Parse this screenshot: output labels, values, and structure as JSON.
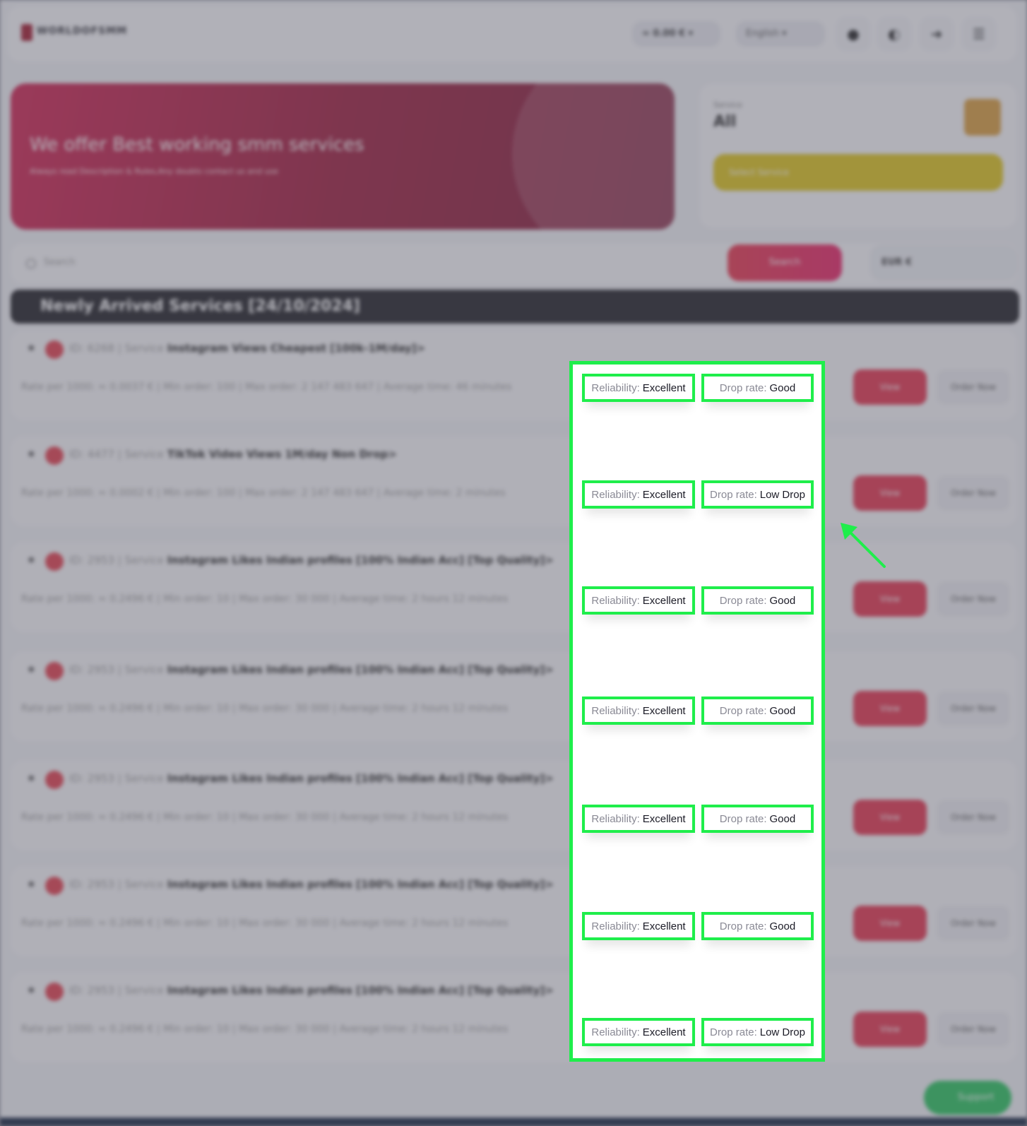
{
  "header": {
    "logo_text": "WORLDOFSMM",
    "balance": "≈ 0.00 € ▾",
    "language": "English ▾"
  },
  "hero": {
    "title": "We offer Best working smm services",
    "subtitle": "Always read Description & Rules,Any doubts contact us and use"
  },
  "service_selector": {
    "label": "Service",
    "value": "All",
    "button": "Select Service"
  },
  "search": {
    "placeholder": "Search",
    "button": "Search",
    "currency": "EUR €"
  },
  "section_title": "Newly Arrived Services [24/10/2024]",
  "services": [
    {
      "id": "ID: 6268",
      "service_label": "Service",
      "service": "Instagram Views Cheapest [100k-1M/day]>",
      "rate": "Rate per 1000: ≈ 0.0037 €",
      "min": "Min order: 100",
      "max": "Max order: 2 147 483 647",
      "avg": "Average time: 46 minutes",
      "reliability_label": "Reliability:",
      "reliability": "Excellent",
      "drop_label": "Drop rate:",
      "drop": "Good",
      "view": "View",
      "order": "Order Now"
    },
    {
      "id": "ID: 4477",
      "service_label": "Service",
      "service": "TikTok Video Views 1M/day Non Drop>",
      "rate": "Rate per 1000: ≈ 0.0002 €",
      "min": "Min order: 100",
      "max": "Max order: 2 147 483 647",
      "avg": "Average time: 2 minutes",
      "reliability_label": "Reliability:",
      "reliability": "Excellent",
      "drop_label": "Drop rate:",
      "drop": "Low Drop",
      "view": "View",
      "order": "Order Now"
    },
    {
      "id": "ID: 2953",
      "service_label": "Service",
      "service": "Instagram Likes Indian profiles [100% Indian Acc] [Top Quality]>",
      "rate": "Rate per 1000: ≈ 0.2496 €",
      "min": "Min order: 10",
      "max": "Max order: 30 000",
      "avg": "Average time: 2 hours 12 minutes",
      "reliability_label": "Reliability:",
      "reliability": "Excellent",
      "drop_label": "Drop rate:",
      "drop": "Good",
      "view": "View",
      "order": "Order Now"
    },
    {
      "id": "ID: 2953",
      "service_label": "Service",
      "service": "Instagram Likes Indian profiles [100% Indian Acc] [Top Quality]>",
      "rate": "Rate per 1000: ≈ 0.2496 €",
      "min": "Min order: 10",
      "max": "Max order: 30 000",
      "avg": "Average time: 2 hours 12 minutes",
      "reliability_label": "Reliability:",
      "reliability": "Excellent",
      "drop_label": "Drop rate:",
      "drop": "Good",
      "view": "View",
      "order": "Order Now"
    },
    {
      "id": "ID: 2953",
      "service_label": "Service",
      "service": "Instagram Likes Indian profiles [100% Indian Acc] [Top Quality]>",
      "rate": "Rate per 1000: ≈ 0.2496 €",
      "min": "Min order: 10",
      "max": "Max order: 30 000",
      "avg": "Average time: 2 hours 12 minutes",
      "reliability_label": "Reliability:",
      "reliability": "Excellent",
      "drop_label": "Drop rate:",
      "drop": "Good",
      "view": "View",
      "order": "Order Now"
    },
    {
      "id": "ID: 2953",
      "service_label": "Service",
      "service": "Instagram Likes Indian profiles [100% Indian Acc] [Top Quality]>",
      "rate": "Rate per 1000: ≈ 0.2496 €",
      "min": "Min order: 10",
      "max": "Max order: 30 000",
      "avg": "Average time: 2 hours 12 minutes",
      "reliability_label": "Reliability:",
      "reliability": "Excellent",
      "drop_label": "Drop rate:",
      "drop": "Good",
      "view": "View",
      "order": "Order Now"
    },
    {
      "id": "ID: 2953",
      "service_label": "Service",
      "service": "Instagram Likes Indian profiles [100% Indian Acc] [Top Quality]>",
      "rate": "Rate per 1000: ≈ 0.2496 €",
      "min": "Min order: 10",
      "max": "Max order: 30 000",
      "avg": "Average time: 2 hours 12 minutes",
      "reliability_label": "Reliability:",
      "reliability": "Excellent",
      "drop_label": "Drop rate:",
      "drop": "Low Drop",
      "view": "View",
      "order": "Order Now"
    }
  ],
  "support_label": "Support",
  "colors": {
    "highlight": "#1fee4b",
    "accent": "#e3304a",
    "section_bar": "#1c1c21"
  }
}
